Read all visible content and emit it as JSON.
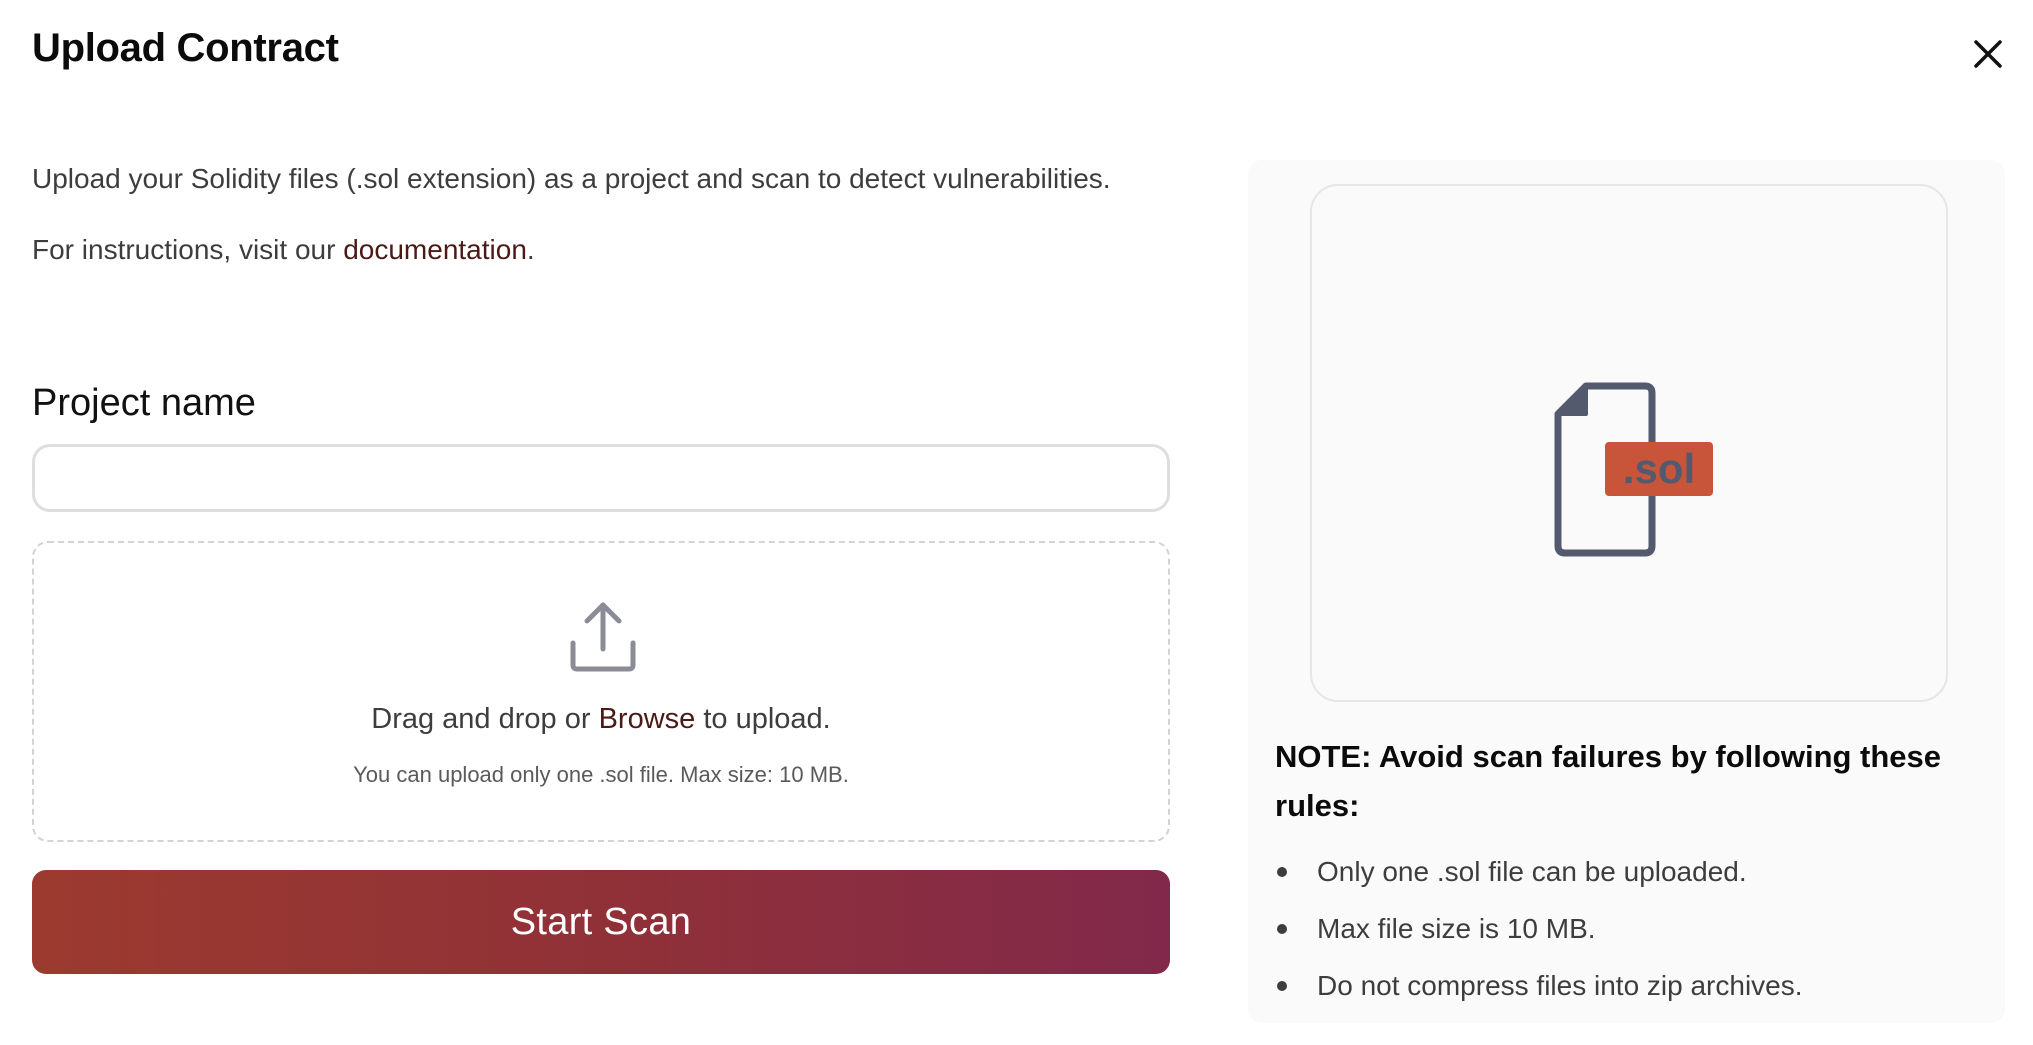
{
  "modal": {
    "title": "Upload Contract",
    "close_icon": "close-icon"
  },
  "intro": {
    "line1": "Upload your Solidity files (.sol extension) as a project and scan to detect vulnerabilities.",
    "line2_prefix": "For instructions, visit our ",
    "line2_link": "documentation",
    "line2_suffix": "."
  },
  "form": {
    "project_label": "Project name",
    "project_value": "",
    "project_placeholder": ""
  },
  "dropzone": {
    "icon": "upload-icon",
    "text_prefix": "Drag and drop or ",
    "browse_link": "Browse",
    "text_suffix": " to upload.",
    "hint": "You can upload only one .sol file. Max size: 10 MB."
  },
  "actions": {
    "start_scan_label": "Start Scan"
  },
  "preview": {
    "file_icon": "sol-file-icon",
    "file_badge": ".sol",
    "badge_color": "#c8553a"
  },
  "notes": {
    "title": "NOTE: Avoid scan failures by following these rules:",
    "rules": [
      "Only one .sol file can be uploaded.",
      "Max file size is 10 MB.",
      "Do not compress files into zip archives."
    ]
  },
  "colors": {
    "button_gradient_start": "#9c3a2f",
    "button_gradient_end": "#82294b",
    "link": "#4b1a17",
    "icon_stroke": "#545a6e"
  }
}
